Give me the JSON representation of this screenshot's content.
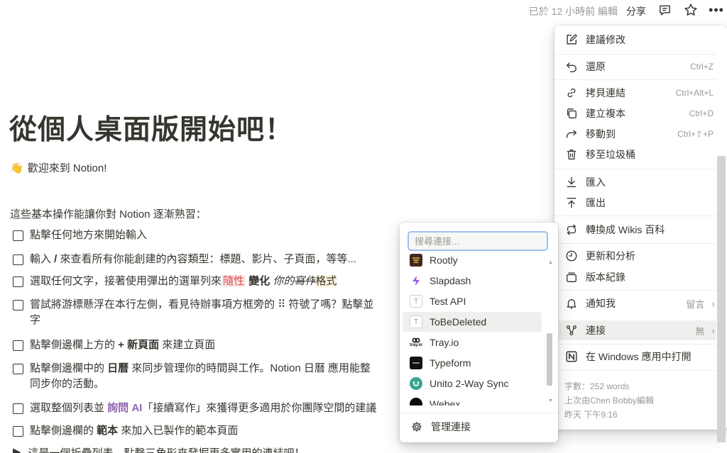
{
  "topbar": {
    "edited": "已於 12 小時前 編輯",
    "share": "分享",
    "more": "•••",
    "icons": [
      "comment-icon",
      "star-icon",
      "more-icon"
    ]
  },
  "page": {
    "title": "從個人桌面版開始吧！",
    "welcome_emoji": "👋",
    "welcome": "歡迎來到 Notion!",
    "intro": "這些基本操作能讓你對 Notion 逐漸熟習："
  },
  "todos": {
    "t1": "點擊任何地方來開始輸入",
    "t2a": "輸入 ",
    "t2b": "/",
    "t2c": " 來查看所有你能創建的內容類型：標題、影片、子頁面，等等...",
    "t3a": "選取任何文字，接著使用彈出的選單列來",
    "t3b": "隨性",
    "t3c": "變化",
    "t3d": "你的",
    "t3e": "寫作",
    "t3f": "格式",
    "t4a": "嘗試將游標懸浮在本行左側，看見待辦事項方框旁的 ⠿ 符號了嗎？點擊並",
    "t4b": "字",
    "t5a": "點擊側邊欄上方的 ",
    "t5b": "+ 新頁面",
    "t5c": " 來建立頁面",
    "t6a": "點擊側邊欄中的 ",
    "t6b": "日曆",
    "t6c": " 來同步管理你的時間與工作。Notion 日曆 應用能整",
    "t6d": "同步你的活動。",
    "t7a": "選取整個列表並 ",
    "t7b": "詢問 AI",
    "t7c": "「接續寫作」來獲得更多適用於你團隊空間的建議",
    "t8a": "點擊側邊欄的 ",
    "t8b": "範本",
    "t8c": " 來加入已製作的範本頁面",
    "toggle": "這是一個折疊列表。點擊三角形來發掘更多實用的連結吧！"
  },
  "menu": {
    "suggest": "建議修改",
    "undo": "還原",
    "undo_sc": "Ctrl+Z",
    "copy_link": "拷貝連結",
    "copy_link_sc": "Ctrl+Alt+L",
    "duplicate": "建立複本",
    "duplicate_sc": "Ctrl+D",
    "move_to": "移動到",
    "move_to_sc": "Ctrl+⇧+P",
    "trash": "移至垃圾桶",
    "import": "匯入",
    "export": "匯出",
    "wiki": "轉換成 Wikis 百科",
    "updates": "更新和分析",
    "history": "版本紀錄",
    "notify": "通知我",
    "notify_val": "留言",
    "connections": "連接",
    "connections_val": "無",
    "open_windows": "在 Windows 應用中打開",
    "word_count": "字數：252 words",
    "last_edited_by": "上次由Chen Bobby編輯",
    "last_edited_time": "昨天 下午9:16"
  },
  "connections": {
    "search_placeholder": "搜尋連接...",
    "items": [
      {
        "name": "Rootly",
        "color": "#3d2a1e"
      },
      {
        "name": "Slapdash",
        "color": "#8b5cf6"
      },
      {
        "name": "Test API",
        "color": "#ffffff"
      },
      {
        "name": "ToBeDeleted",
        "color": "#ffffff"
      },
      {
        "name": "Tray.io",
        "color": "#111111"
      },
      {
        "name": "Typeform",
        "color": "#111111"
      },
      {
        "name": "Unito 2-Way Sync",
        "color": "#3aa58f"
      },
      {
        "name": "Webex",
        "color": "#0a0a0a"
      }
    ],
    "logo_letters": {
      "test": "T",
      "tobe": "T",
      "tray": "tray.io"
    },
    "manage": "管理連接"
  },
  "colors": {
    "accent_focus": "#9dc2f0",
    "text": "#37352f",
    "muted": "#9b9a97",
    "ai_purple": "#9065b0",
    "highlight_red": "#d44c47"
  }
}
